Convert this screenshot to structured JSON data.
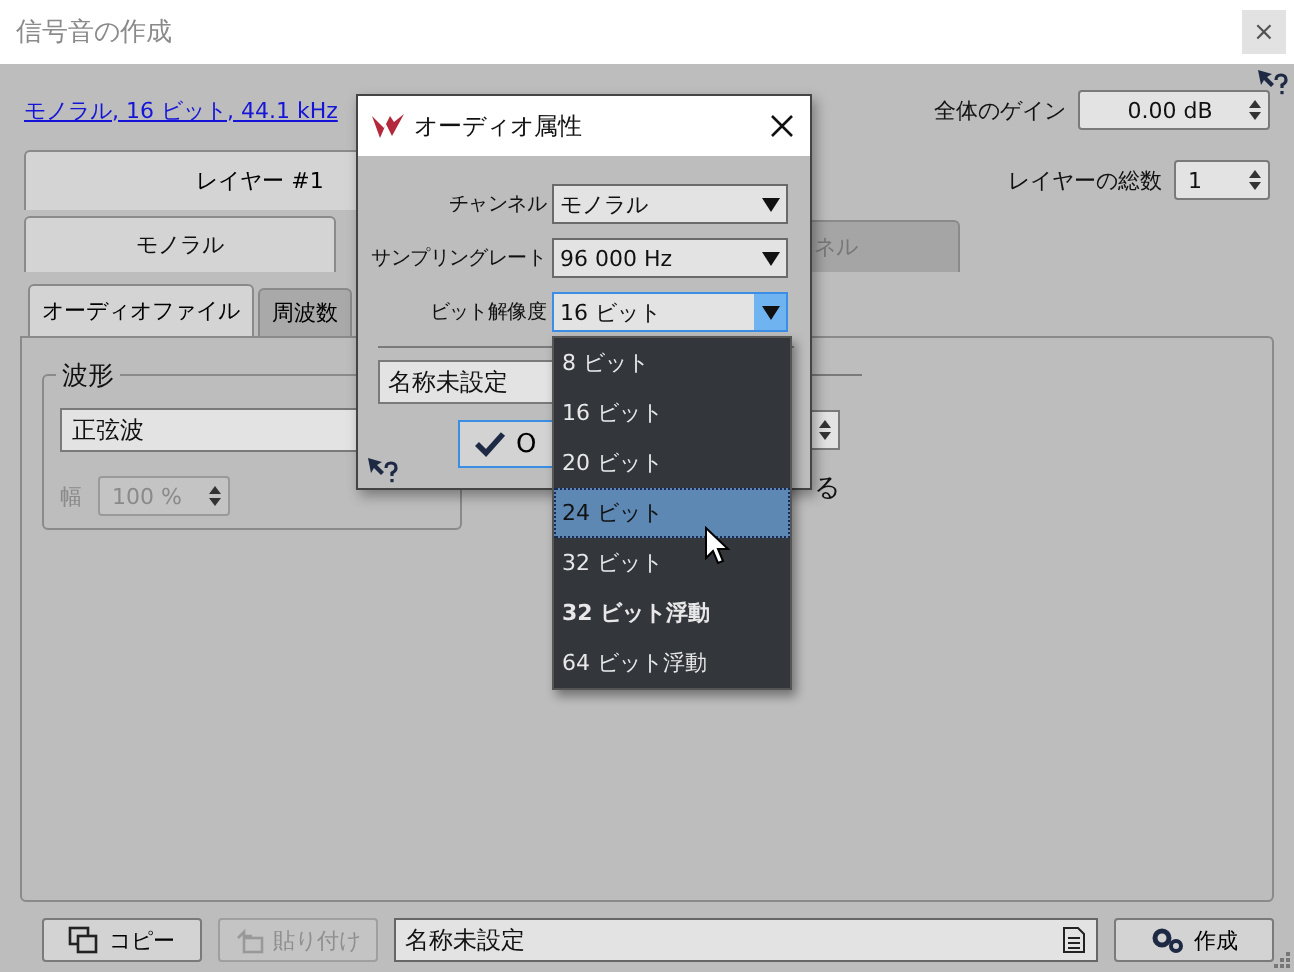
{
  "window": {
    "title": "信号音の作成",
    "close": "×"
  },
  "format_link": "モノラル, 16 ビット, 44.1 kHz",
  "gain": {
    "label": "全体のゲイン",
    "value": "0.00 dB"
  },
  "layer_tab": {
    "label": "レイヤー #1",
    "selected": true
  },
  "layer_count": {
    "label": "レイヤーの総数",
    "value": "1"
  },
  "channel_tabs": [
    {
      "label": "モノラル",
      "selected": true,
      "disabled": false
    },
    {
      "label": "ネル",
      "selected": false,
      "disabled": true
    }
  ],
  "source_tabs": [
    {
      "label": "オーディオファイル",
      "selected": true
    },
    {
      "label": "周波数",
      "selected": false
    }
  ],
  "waveform": {
    "legend": "波形",
    "value": "正弦波",
    "width_label": "幅",
    "width_value": "100 %",
    "width_disabled": true
  },
  "option_fragment": "る",
  "bottom": {
    "copy": "コピー",
    "paste": "貼り付け",
    "paste_disabled": true,
    "name": "名称未設定",
    "create": "作成"
  },
  "dialog": {
    "title": "オーディオ属性",
    "fields": [
      {
        "label": "チャンネル",
        "value": "モノラル",
        "focused": false
      },
      {
        "label": "サンプリングレート",
        "value": "96 000 Hz",
        "focused": false
      },
      {
        "label": "ビット解像度",
        "value": "16 ビット",
        "focused": true
      }
    ],
    "name": "名称未設定",
    "ok": "O",
    "options": [
      {
        "label": "8 ビット",
        "selected": false,
        "emphasized": false
      },
      {
        "label": "16 ビット",
        "selected": false,
        "emphasized": false
      },
      {
        "label": "20 ビット",
        "selected": false,
        "emphasized": false
      },
      {
        "label": "24 ビット",
        "selected": true,
        "emphasized": false
      },
      {
        "label": "32 ビット",
        "selected": false,
        "emphasized": false
      },
      {
        "label": "32 ビット浮動",
        "selected": false,
        "emphasized": true
      },
      {
        "label": "64 ビット浮動",
        "selected": false,
        "emphasized": false
      }
    ]
  }
}
